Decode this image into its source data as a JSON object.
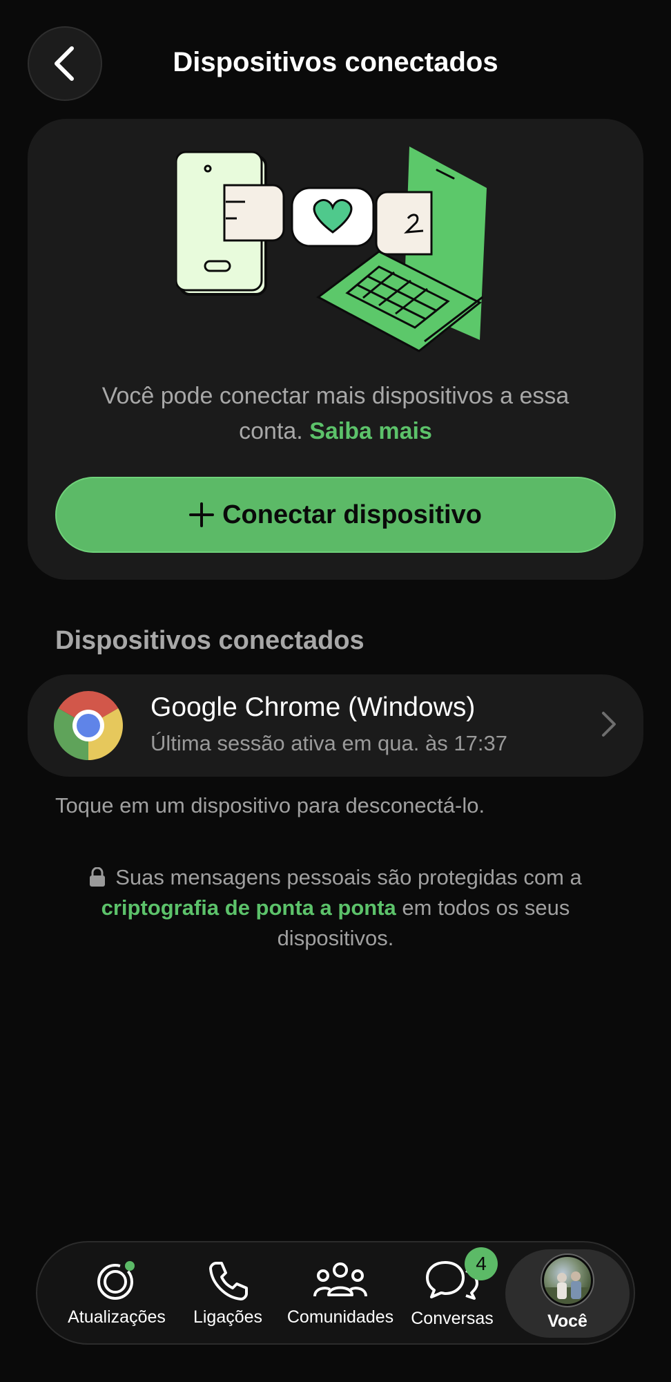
{
  "header": {
    "back_icon": "chevron-left-icon",
    "title": "Dispositivos conectados"
  },
  "hero": {
    "description": "Você pode conectar mais dispositivos a essa conta.",
    "learn_more": "Saiba mais",
    "connect_button": "Conectar dispositivo",
    "connect_icon": "plus-icon"
  },
  "section": {
    "title": "Dispositivos conectados"
  },
  "devices": [
    {
      "icon": "chrome-icon",
      "name": "Google Chrome (Windows)",
      "last_active": "Última sessão ativa em qua. às 17:37"
    }
  ],
  "hint": "Toque em um dispositivo para desconectá-lo.",
  "encryption": {
    "prefix": "Suas mensagens pessoais são protegidas com a",
    "link": "criptografia de ponta a ponta",
    "suffix": "em todos os seus dispositivos."
  },
  "tabbar": {
    "tabs": [
      {
        "label": "Atualizações",
        "icon": "updates-icon"
      },
      {
        "label": "Ligações",
        "icon": "phone-icon"
      },
      {
        "label": "Comunidades",
        "icon": "communities-icon"
      },
      {
        "label": "Conversas",
        "icon": "chats-icon",
        "badge": "4"
      },
      {
        "label": "Você",
        "icon": "avatar",
        "active": true
      }
    ]
  },
  "colors": {
    "background": "#0a0a0a",
    "card": "#1b1b1b",
    "accent": "#5cba67",
    "link": "#5cc26a",
    "muted_text": "#a8a8a8"
  }
}
